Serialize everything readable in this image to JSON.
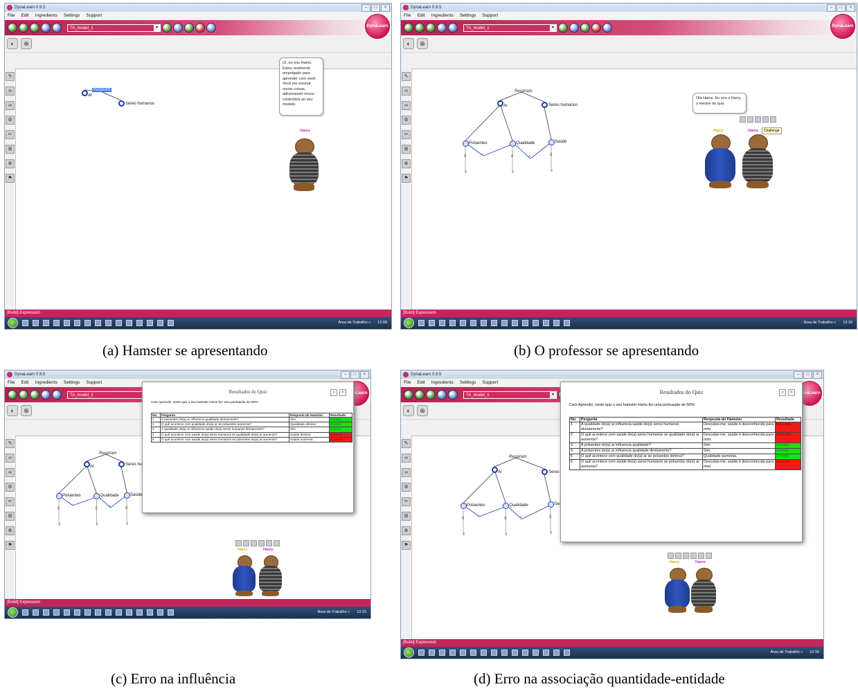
{
  "app": {
    "window_title": "DynaLearn 0.9.5",
    "menu": [
      "File",
      "Edit",
      "Ingredients",
      "Settings",
      "Support"
    ],
    "model_name": "TA_model_1",
    "logo_text": "DynaLearn",
    "status_text": "[Build] Expression",
    "tray_text": "Área de Trabalho »"
  },
  "model": {
    "relation_label": "Respiram",
    "entity_air": "Ar",
    "entity_humans": "Seres humanos",
    "quantities": [
      "Poluentes",
      "Qualidade",
      "Saúde"
    ],
    "minus": "−",
    "plus": "+",
    "ms_zero": "δ"
  },
  "characters": {
    "hamster": "Hams",
    "teacher": "Harry",
    "challenge": "Challenge"
  },
  "panels": [
    {
      "caption": "(a)  Hamster se apresentando",
      "clock": "12:08",
      "bubble": "Oi, eu sou Hams. Estou realmente empolgado para aprender com você. Você me ensinar novas coisas, adicionando novos conteúdos ao seu modelo."
    },
    {
      "caption": "(b)  O professor se apresentando",
      "clock": "12:10",
      "bubble": "Olá Hams. Eu sou o Harry, o mestre do quiz."
    },
    {
      "caption": "(c) Erro na influência",
      "clock": "12:15",
      "quiz": {
        "title": "Resultados do Quiz",
        "intro": "Caro Aprendiz, neste quiz o seu hamster Hams fez uma pontuação de 60%!",
        "headers": [
          "No.",
          "Pergunta",
          "Resposta do Hamster",
          "Resultado"
        ],
        "rows": [
          {
            "no": "1",
            "q": "A poluentes do(a) ar influencia qualidade diretamente?",
            "a": "Sim.",
            "r": "Correto",
            "ok": true
          },
          {
            "no": "2",
            "q": "O quê acontece com qualidade do(a) ar se poluentes aumenta?",
            "a": "Qualidade diminui.",
            "r": "Correto",
            "ok": true
          },
          {
            "no": "3",
            "q": "A qualidade do(a) ar influencia saúde do(a) seres humanos diretamente?",
            "a": "Sim.",
            "r": "Correto",
            "ok": true
          },
          {
            "no": "4",
            "q": "O quê acontece com saúde do(a) seres humanos se qualidade do(a) ar aumenta?",
            "a": "Saúde diminui.",
            "r": "Incorreto",
            "ok": false
          },
          {
            "no": "5",
            "q": "O quê acontece com saúde do(a) seres humanos se poluentes do(a) ar aumenta?",
            "a": "Saúde aumenta.",
            "r": "Incorreto",
            "ok": false
          }
        ]
      }
    },
    {
      "caption": "(d)  Erro na associação quantidade-entidade",
      "clock": "12:15",
      "quiz": {
        "title": "Resultados do Quiz",
        "intro": "Caro Aprendiz, neste quiz o seu hamster Hams fez uma pontuação de 50%!",
        "headers": [
          "No.",
          "Pergunta",
          "Resposta do Hamster",
          "Resultado"
        ],
        "rows": [
          {
            "no": "1",
            "q": "A qualidade do(a) ar influencia saúde do(a) seres humanos diretamente?",
            "a": "Desculpe-me, saúde é desconhecida para mim.",
            "r": "Incorreto",
            "ok": false
          },
          {
            "no": "2",
            "q": "O quê acontece com saúde do(a) seres humanos se qualidade do(a) ar aumenta?",
            "a": "Desculpe-me, saúde é desconhecida para mim.",
            "r": "Incorreto",
            "ok": false
          },
          {
            "no": "3",
            "q": "A poluentes do(a) ar influencia qualidade?",
            "a": "Sim.",
            "r": "Correto",
            "ok": true
          },
          {
            "no": "4",
            "q": "A poluentes do(a) ar influencia qualidade diretamente?",
            "a": "Sim.",
            "r": "Correto",
            "ok": true
          },
          {
            "no": "5",
            "q": "O quê acontece com qualidade do(a) ar se poluentes diminui?",
            "a": "Qualidade aumenta.",
            "r": "Correto",
            "ok": true
          },
          {
            "no": "6",
            "q": "O quê acontece com saúde do(a) seres humanos se poluentes do(a) ar aumenta?",
            "a": "Desculpe-me, saúde é desconhecida para mim.",
            "r": "Incorreto",
            "ok": false
          }
        ]
      }
    }
  ],
  "colors": {
    "toolbar": "#b6204d",
    "statusbar": "#c2255a",
    "correct": "#19e019",
    "incorrect": "#f01a1a",
    "entity": "#1a3aa0"
  }
}
